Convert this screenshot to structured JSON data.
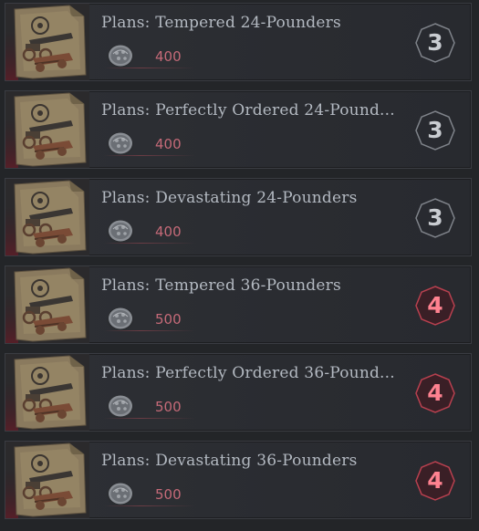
{
  "colors": {
    "tier_3_text": "#c9ccd1",
    "tier_3_border": "#7f838a",
    "tier_4_text": "#ff8290",
    "tier_4_border": "#b8404f",
    "tier_4_fill": "#3a1f26",
    "price_text": "#c56a78",
    "title_text": "#b3b9c1"
  },
  "items": [
    {
      "title": "Plans: Tempered 24-Pounders",
      "price": "400",
      "tier": "3",
      "icon": "cannon-schematic-icon",
      "currency_icon": "silver-coin-icon"
    },
    {
      "title": "Plans: Perfectly Ordered 24-Pound...",
      "price": "400",
      "tier": "3",
      "icon": "cannon-schematic-icon",
      "currency_icon": "silver-coin-icon"
    },
    {
      "title": "Plans: Devastating 24-Pounders",
      "price": "400",
      "tier": "3",
      "icon": "cannon-schematic-icon",
      "currency_icon": "silver-coin-icon"
    },
    {
      "title": "Plans: Tempered 36-Pounders",
      "price": "500",
      "tier": "4",
      "icon": "cannon-schematic-icon",
      "currency_icon": "silver-coin-icon"
    },
    {
      "title": "Plans: Perfectly Ordered 36-Pound...",
      "price": "500",
      "tier": "4",
      "icon": "cannon-schematic-icon",
      "currency_icon": "silver-coin-icon"
    },
    {
      "title": "Plans: Devastating 36-Pounders",
      "price": "500",
      "tier": "4",
      "icon": "cannon-schematic-icon",
      "currency_icon": "silver-coin-icon"
    }
  ]
}
